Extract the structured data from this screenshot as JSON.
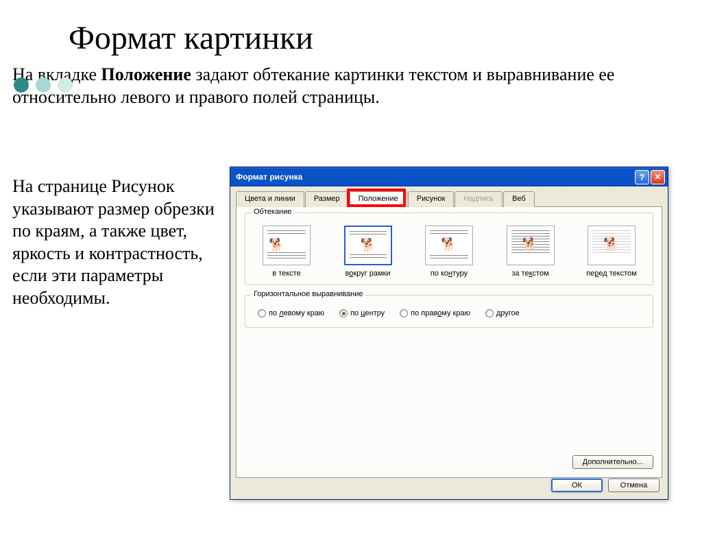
{
  "slide": {
    "title": "Формат картинки",
    "para1_pre": "На вкладке ",
    "para1_bold": "Положение",
    "para1_post": " задают обтекание картинки текстом и выравнивание ее относительно левого и правого полей страницы.",
    "para2_pre": "На странице ",
    "para2_bold": "Рисунок",
    "para2_post": " указывают размер обрезки по краям, а также цвет, яркость и контрастность, если эти параметры необходимы."
  },
  "dialog": {
    "title": "Формат рисунка",
    "tabs": {
      "colors": "Цвета и линии",
      "size": "Размер",
      "position": "Положение",
      "picture": "Рисунок",
      "textbox": "Надпись",
      "web": "Веб"
    },
    "group_wrap": "Обтекание",
    "wrap": {
      "inline_pre": "в тексте",
      "inline_u": "",
      "square_pre": "в",
      "square_u": "о",
      "square_post": "круг рамки",
      "tight_pre": "по ко",
      "tight_u": "н",
      "tight_post": "туру",
      "behind_pre": "за те",
      "behind_u": "к",
      "behind_post": "стом",
      "front_pre": "пе",
      "front_u": "р",
      "front_post": "ед текстом"
    },
    "group_align": "Горизонтальное выравнивание",
    "align": {
      "left_pre": "по ",
      "left_u": "л",
      "left_post": "евому краю",
      "center_pre": "по ",
      "center_u": "ц",
      "center_post": "ентру",
      "right_pre": "по прав",
      "right_u": "о",
      "right_post": "му краю",
      "other_pre": "",
      "other_u": "д",
      "other_post": "ругое"
    },
    "advanced": "Дополнительно...",
    "ok": "ОК",
    "cancel": "Отмена"
  }
}
